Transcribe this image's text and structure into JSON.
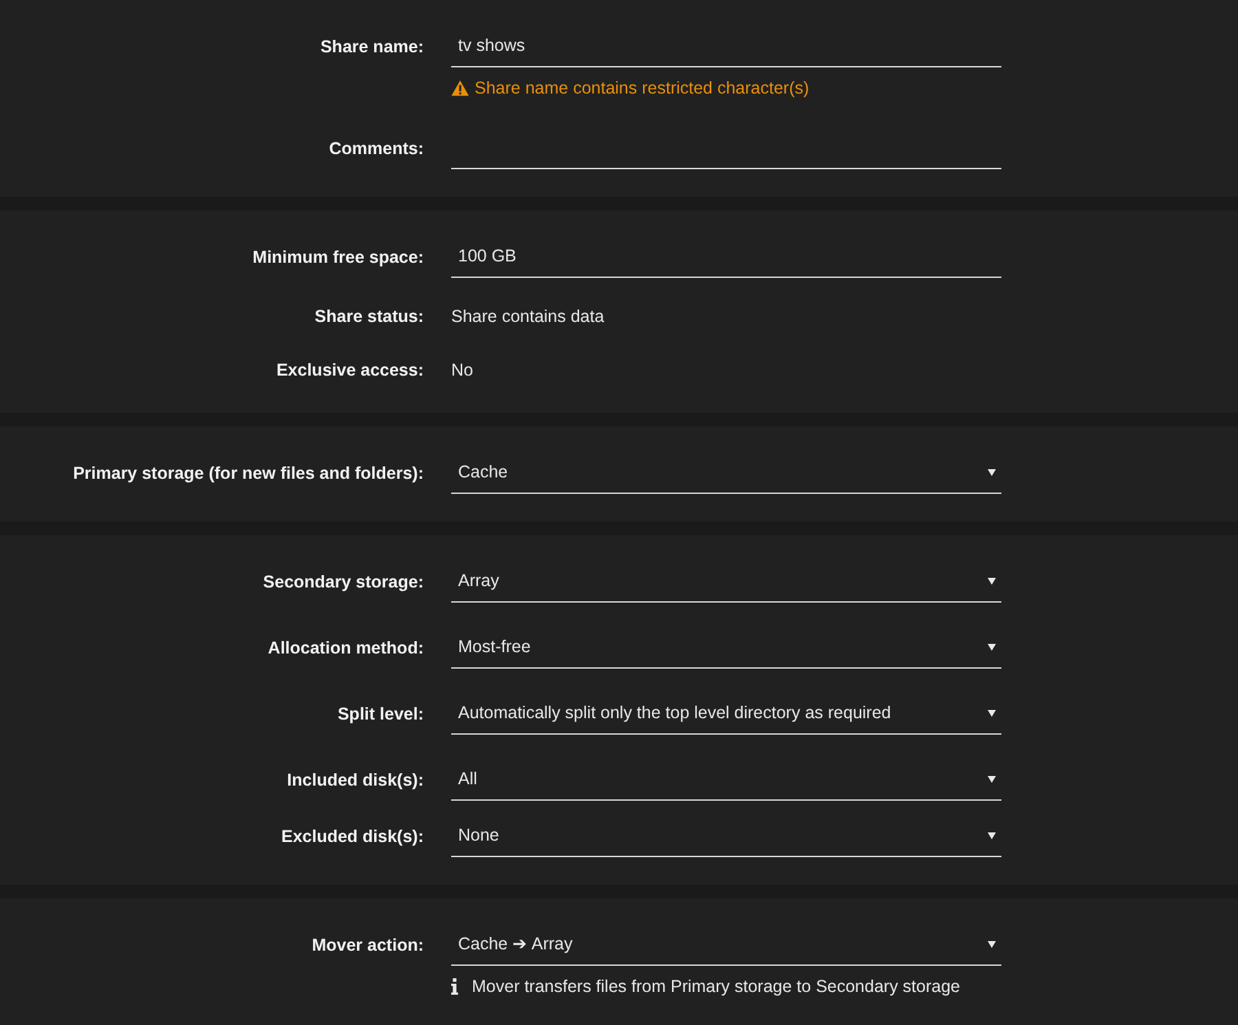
{
  "sections": [
    {
      "fields": [
        {
          "kind": "input",
          "label": "Share name:",
          "value": "tv shows",
          "message": {
            "kind": "warning",
            "text": "Share name contains restricted character(s)"
          }
        },
        {
          "kind": "input",
          "label": "Comments:"
        }
      ]
    },
    {
      "fields": [
        {
          "kind": "input",
          "label": "Minimum free space:",
          "value": "100 GB"
        },
        {
          "kind": "static",
          "label": "Share status:",
          "value": "Share contains data"
        },
        {
          "kind": "static",
          "label": "Exclusive access:",
          "value": "No"
        }
      ]
    },
    {
      "fields": [
        {
          "kind": "select",
          "label": "Primary storage (for new files and folders):",
          "value": "Cache"
        }
      ]
    },
    {
      "fields": [
        {
          "kind": "select",
          "label": "Secondary storage:",
          "value": "Array"
        },
        {
          "kind": "select",
          "label": "Allocation method:",
          "value": "Most-free"
        },
        {
          "kind": "select",
          "label": "Split level:",
          "value": "Automatically split only the top level directory as required"
        },
        {
          "kind": "multiselect",
          "label": "Included disk(s):",
          "value": "All"
        },
        {
          "kind": "multiselect",
          "label": "Excluded disk(s):",
          "value": "None"
        }
      ]
    },
    {
      "fields": [
        {
          "kind": "select",
          "label": "Mover action:",
          "value": "Cache ➔ Array",
          "message": {
            "kind": "info",
            "text": "Mover transfers files from Primary storage to Secondary storage"
          }
        }
      ]
    }
  ]
}
